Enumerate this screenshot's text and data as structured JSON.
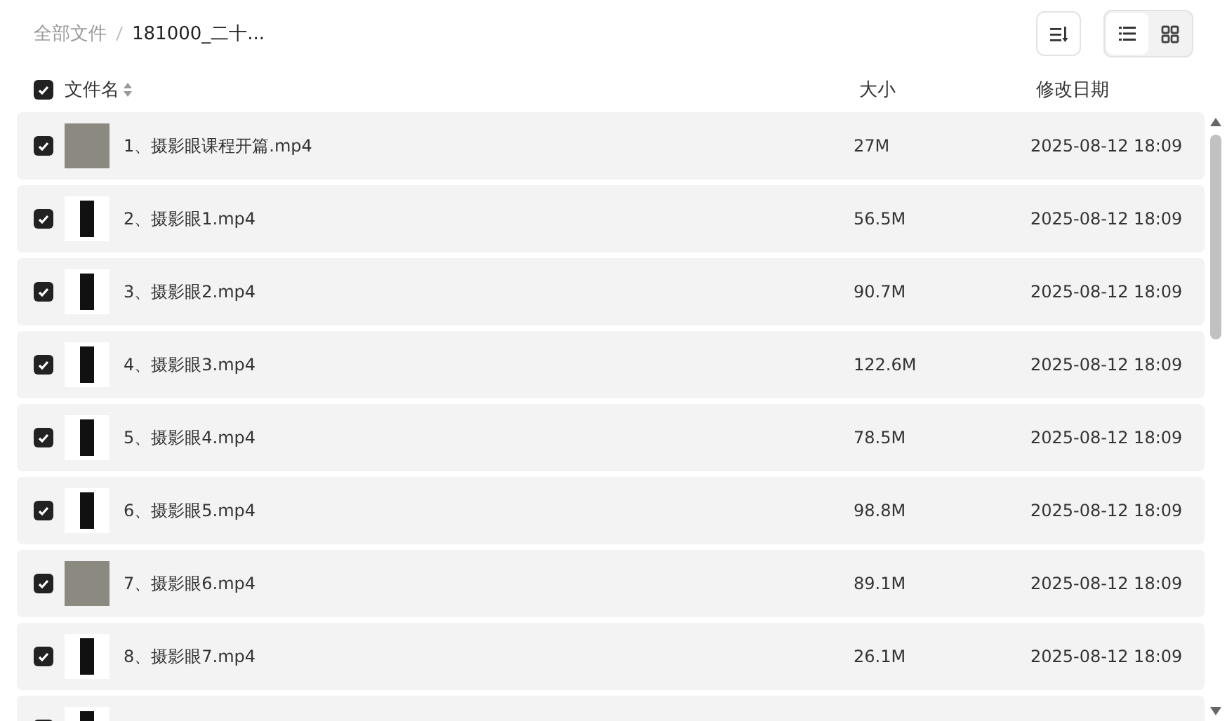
{
  "breadcrumb": [
    {
      "label": "全部文件",
      "current": false
    },
    {
      "label": "181000_二十...",
      "current": true
    }
  ],
  "view_toggle": [
    {
      "kind": "list",
      "selected": true
    },
    {
      "kind": "grid",
      "selected": false
    }
  ],
  "header": {
    "checked": true,
    "name": "文件名",
    "size": "大小",
    "date": "修改日期"
  },
  "rows": [
    {
      "checked": true,
      "kind": "photo",
      "name": "1、摄影眼课程开篇.mp4",
      "size": "27M",
      "date": "2025-08-12 18:09"
    },
    {
      "checked": true,
      "kind": "phone",
      "name": "2、摄影眼1.mp4",
      "size": "56.5M",
      "date": "2025-08-12 18:09"
    },
    {
      "checked": true,
      "kind": "phone",
      "name": "3、摄影眼2.mp4",
      "size": "90.7M",
      "date": "2025-08-12 18:09"
    },
    {
      "checked": true,
      "kind": "phone",
      "name": "4、摄影眼3.mp4",
      "size": "122.6M",
      "date": "2025-08-12 18:09"
    },
    {
      "checked": true,
      "kind": "phone",
      "name": "5、摄影眼4.mp4",
      "size": "78.5M",
      "date": "2025-08-12 18:09"
    },
    {
      "checked": true,
      "kind": "phone",
      "name": "6、摄影眼5.mp4",
      "size": "98.8M",
      "date": "2025-08-12 18:09"
    },
    {
      "checked": true,
      "kind": "photo",
      "name": "7、摄影眼6.mp4",
      "size": "89.1M",
      "date": "2025-08-12 18:09"
    },
    {
      "checked": true,
      "kind": "phone",
      "name": "8、摄影眼7.mp4",
      "size": "26.1M",
      "date": "2025-08-12 18:09"
    },
    {
      "checked": true,
      "kind": "phone"
    }
  ]
}
